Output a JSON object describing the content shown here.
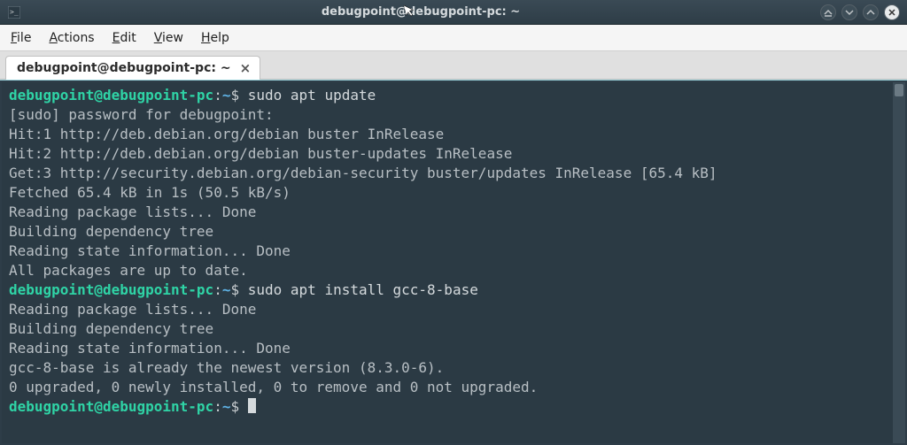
{
  "titlebar": {
    "title": "debugpoint@debugpoint-pc: ~"
  },
  "menubar": {
    "file": "File",
    "actions": "Actions",
    "edit": "Edit",
    "view": "View",
    "help": "Help"
  },
  "tab": {
    "label": "debugpoint@debugpoint-pc: ~",
    "close": "×"
  },
  "prompt": {
    "userhost": "debugpoint@debugpoint-pc",
    "colon": ":",
    "path": "~",
    "dollar": "$"
  },
  "cmd1": "sudo apt update",
  "out": {
    "l0": "[sudo] password for debugpoint:",
    "l1": "Hit:1 http://deb.debian.org/debian buster InRelease",
    "l2": "Hit:2 http://deb.debian.org/debian buster-updates InRelease",
    "l3": "Get:3 http://security.debian.org/debian-security buster/updates InRelease [65.4 kB]",
    "l4": "Fetched 65.4 kB in 1s (50.5 kB/s)",
    "l5": "Reading package lists... Done",
    "l6": "Building dependency tree",
    "l7": "Reading state information... Done",
    "l8": "All packages are up to date."
  },
  "cmd2": "sudo apt install gcc-8-base",
  "out2": {
    "l0": "Reading package lists... Done",
    "l1": "Building dependency tree",
    "l2": "Reading state information... Done",
    "l3": "gcc-8-base is already the newest version (8.3.0-6).",
    "l4": "0 upgraded, 0 newly installed, 0 to remove and 0 not upgraded."
  }
}
